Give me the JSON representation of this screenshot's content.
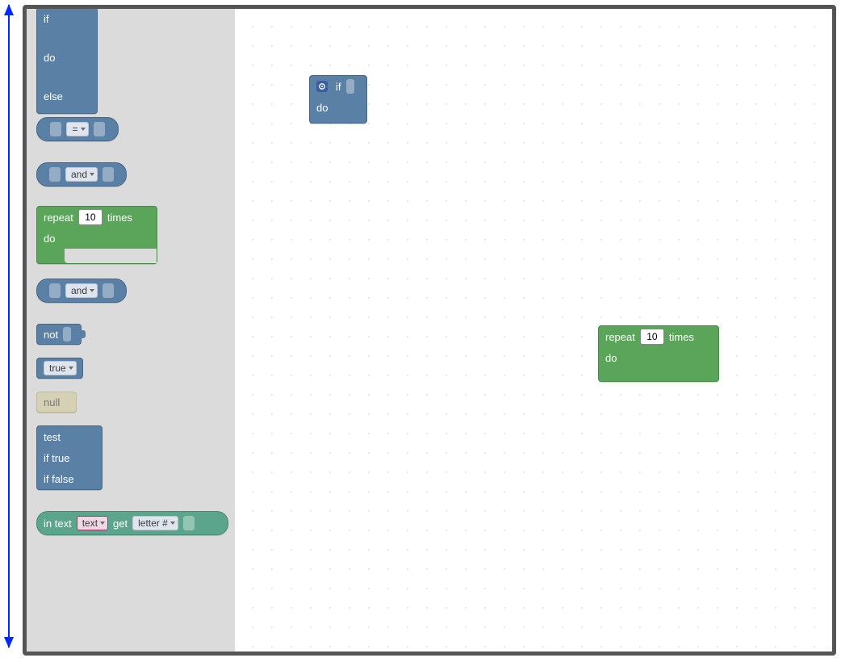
{
  "colors": {
    "logic": "#5b80a5",
    "loop": "#5ba55b",
    "null": "#d6d0b4",
    "text_block": "#5ba58c",
    "arrow": "#0029ff",
    "window_border": "#555555",
    "toolbox_bg": "#dbdbdb"
  },
  "toolbox": {
    "if_else": {
      "if": "if",
      "do": "do",
      "else": "else"
    },
    "compare": {
      "op": "="
    },
    "and1": {
      "op": "and"
    },
    "repeat": {
      "repeat": "repeat",
      "value": "10",
      "times": "times",
      "do": "do"
    },
    "and2": {
      "op": "and"
    },
    "not": {
      "label": "not"
    },
    "true": {
      "label": "true"
    },
    "null": {
      "label": "null"
    },
    "ternary": {
      "test": "test",
      "if_true": "if true",
      "if_false": "if false"
    },
    "in_text": {
      "in_text": "in text",
      "var": "text",
      "get": "get",
      "mode": "letter #"
    }
  },
  "workspace": {
    "if_block": {
      "if": "if",
      "do": "do",
      "mutator_icon": "gear"
    },
    "repeat_block": {
      "repeat": "repeat",
      "value": "10",
      "times": "times",
      "do": "do"
    }
  }
}
